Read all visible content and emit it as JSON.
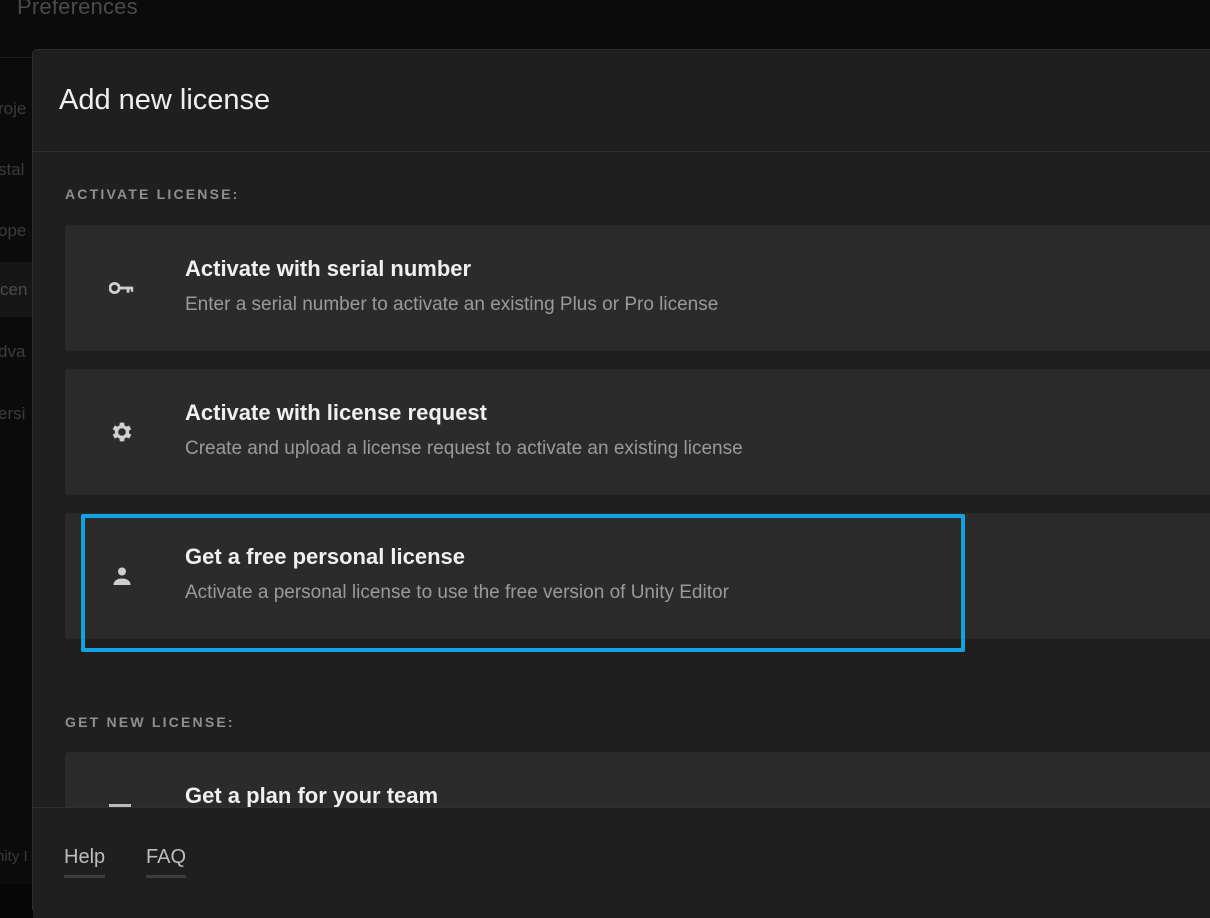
{
  "background_window": {
    "title": "Preferences",
    "nav_items": [
      "roje",
      "stal",
      "ope",
      "cen",
      "dva",
      "ersi"
    ],
    "footer_text": "nity I"
  },
  "dialog": {
    "title": "Add new license",
    "activate_section": {
      "heading": "ACTIVATE LICENSE:",
      "options": [
        {
          "icon": "key-icon",
          "title": "Activate with serial number",
          "description": "Enter a serial number to activate an existing Plus or Pro license"
        },
        {
          "icon": "gear-icon",
          "title": "Activate with license request",
          "description": "Create and upload a license request to activate an existing license"
        },
        {
          "icon": "person-icon",
          "title": "Get a free personal license",
          "description": "Activate a personal license to use the free version of Unity Editor"
        }
      ]
    },
    "get_new_section": {
      "heading": "GET NEW LICENSE:",
      "options": [
        {
          "icon": "team-icon",
          "title": "Get a plan for your team"
        }
      ]
    },
    "footer": {
      "help_label": "Help",
      "faq_label": "FAQ"
    }
  },
  "colors": {
    "highlight": "#12a3e3",
    "card": "#2b2b2b",
    "dialog": "#1f1f1f"
  }
}
